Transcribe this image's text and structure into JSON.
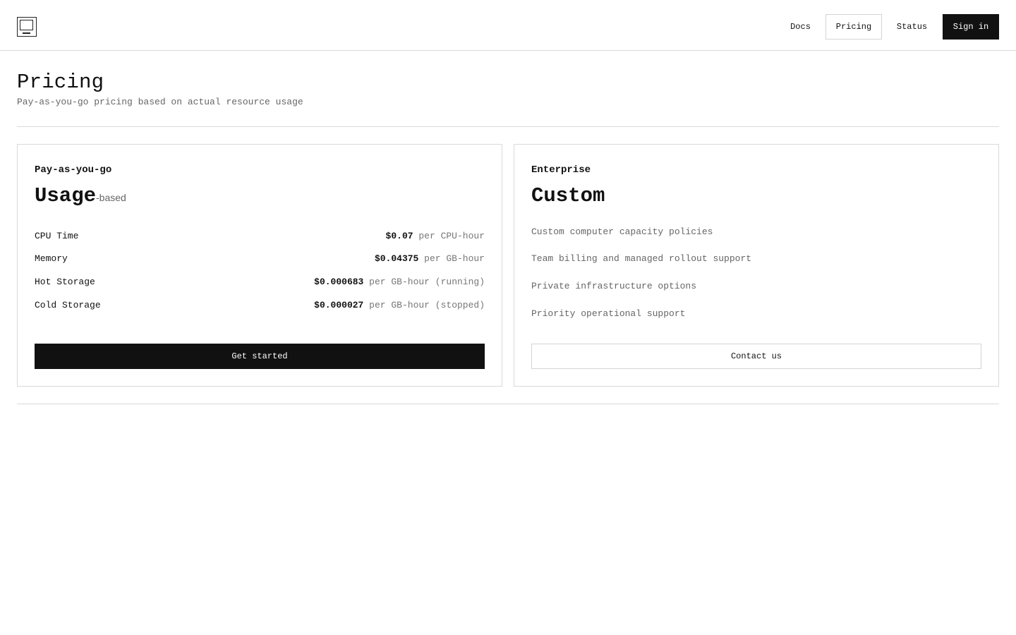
{
  "header": {
    "logo_icon": "computer-monitor-icon",
    "nav": {
      "docs": "Docs",
      "pricing": "Pricing",
      "status": "Status",
      "signin": "Sign in"
    }
  },
  "page": {
    "title": "Pricing",
    "subtitle": "Pay-as-you-go pricing based on actual resource usage"
  },
  "plans": [
    {
      "name": "Pay-as-you-go",
      "headline": "Usage",
      "headline_suffix": "-based",
      "rates": [
        {
          "label": "CPU Time",
          "price": "$0.07",
          "unit": "per CPU-hour"
        },
        {
          "label": "Memory",
          "price": "$0.04375",
          "unit": "per GB-hour"
        },
        {
          "label": "Hot Storage",
          "price": "$0.000683",
          "unit": "per GB-hour (running)"
        },
        {
          "label": "Cold Storage",
          "price": "$0.000027",
          "unit": "per GB-hour (stopped)"
        }
      ],
      "cta": "Get started"
    },
    {
      "name": "Enterprise",
      "headline": "Custom",
      "features": [
        "Custom computer capacity policies",
        "Team billing and managed rollout support",
        "Private infrastructure options",
        "Priority operational support"
      ],
      "cta": "Contact us"
    }
  ],
  "colors": {
    "primary": "#111111",
    "muted_text": "#666666",
    "border": "#d9d9d9",
    "background": "#ffffff"
  }
}
